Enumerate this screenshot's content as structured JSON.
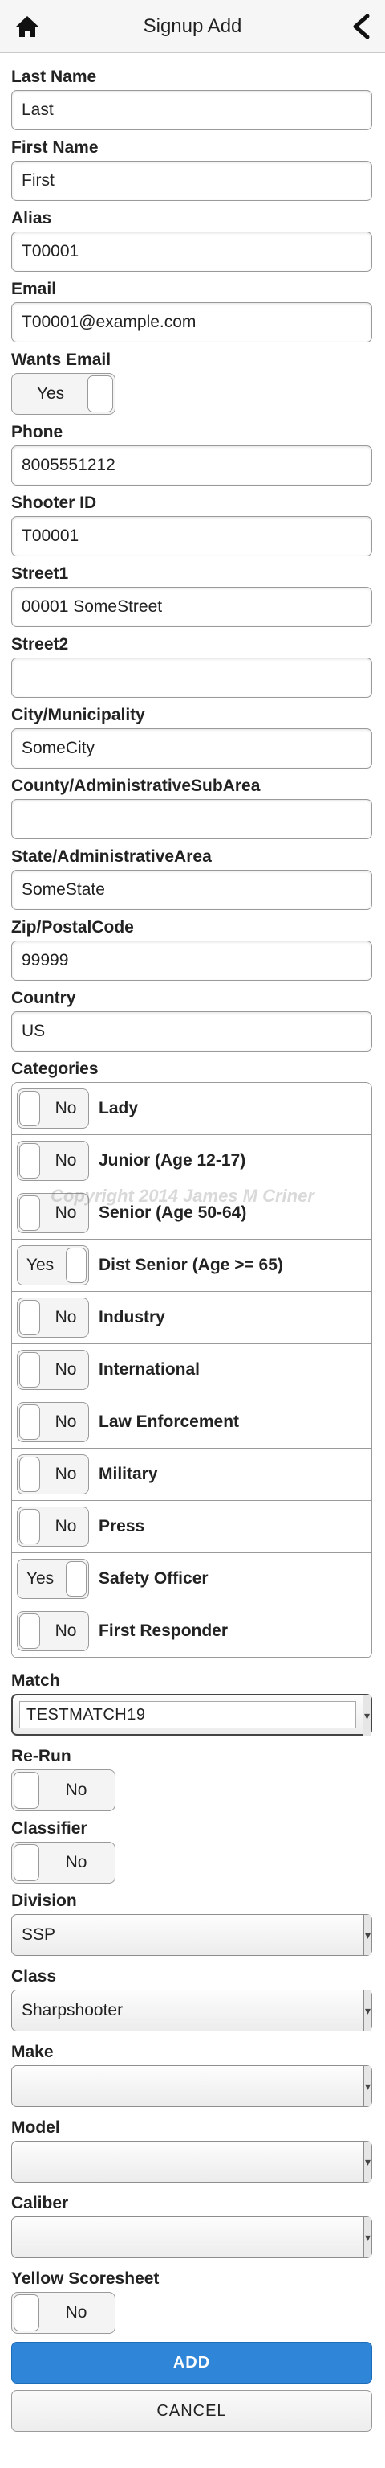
{
  "header": {
    "title": "Signup Add"
  },
  "fields": {
    "last_name": {
      "label": "Last Name",
      "value": "Last"
    },
    "first_name": {
      "label": "First Name",
      "value": "First"
    },
    "alias": {
      "label": "Alias",
      "value": "T00001"
    },
    "email": {
      "label": "Email",
      "value": "T00001@example.com"
    },
    "wants_email": {
      "label": "Wants Email",
      "value": "Yes"
    },
    "phone": {
      "label": "Phone",
      "value": "8005551212"
    },
    "shooter_id": {
      "label": "Shooter ID",
      "value": "T00001"
    },
    "street1": {
      "label": "Street1",
      "value": "00001 SomeStreet"
    },
    "street2": {
      "label": "Street2",
      "value": ""
    },
    "city": {
      "label": "City/Municipality",
      "value": "SomeCity"
    },
    "county": {
      "label": "County/AdministrativeSubArea",
      "value": ""
    },
    "state": {
      "label": "State/AdministrativeArea",
      "value": "SomeState"
    },
    "zip": {
      "label": "Zip/PostalCode",
      "value": "99999"
    },
    "country": {
      "label": "Country",
      "value": "US"
    }
  },
  "categories": {
    "label": "Categories",
    "watermark": "Copyright 2014 James M Criner",
    "items": [
      {
        "label": "Lady",
        "value": "No"
      },
      {
        "label": "Junior (Age 12-17)",
        "value": "No"
      },
      {
        "label": "Senior (Age 50-64)",
        "value": "No"
      },
      {
        "label": "Dist Senior (Age >= 65)",
        "value": "Yes"
      },
      {
        "label": "Industry",
        "value": "No"
      },
      {
        "label": "International",
        "value": "No"
      },
      {
        "label": "Law Enforcement",
        "value": "No"
      },
      {
        "label": "Military",
        "value": "No"
      },
      {
        "label": "Press",
        "value": "No"
      },
      {
        "label": "Safety Officer",
        "value": "Yes"
      },
      {
        "label": "First Responder",
        "value": "No"
      }
    ]
  },
  "match": {
    "label": "Match",
    "value": "TESTMATCH19"
  },
  "rerun": {
    "label": "Re-Run",
    "value": "No"
  },
  "classifier": {
    "label": "Classifier",
    "value": "No"
  },
  "division": {
    "label": "Division",
    "value": "SSP"
  },
  "class": {
    "label": "Class",
    "value": "Sharpshooter"
  },
  "make": {
    "label": "Make",
    "value": ""
  },
  "model": {
    "label": "Model",
    "value": ""
  },
  "caliber": {
    "label": "Caliber",
    "value": ""
  },
  "yellow_scoresheet": {
    "label": "Yellow Scoresheet",
    "value": "No"
  },
  "actions": {
    "add_label": "ADD",
    "cancel_label": "CANCEL"
  },
  "colors": {
    "accent": "#2f86d8",
    "header_bg": "#f6f6f6"
  },
  "icons": {
    "home": "home-icon",
    "back": "chevron-left-icon"
  }
}
